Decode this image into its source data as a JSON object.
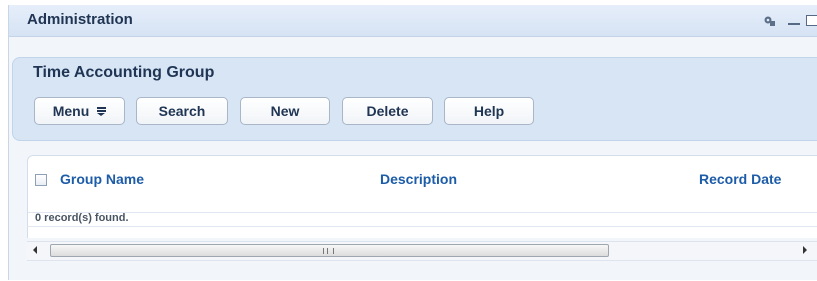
{
  "portlet": {
    "title": "Administration",
    "icons": [
      "refresh-icon",
      "minimize-icon",
      "maximize-icon"
    ]
  },
  "toolbar": {
    "title": "Time Accounting Group",
    "buttons": {
      "menu": "Menu",
      "search": "Search",
      "new": "New",
      "delete": "Delete",
      "help": "Help"
    }
  },
  "grid": {
    "columns": [
      "Group Name",
      "Description",
      "Record Date"
    ],
    "status": "0 record(s) found.",
    "rows": []
  },
  "scrollbar": {
    "grip": "III"
  },
  "colors": {
    "header_bg": "#d6e3f4",
    "panel_bg": "#d7e5f5",
    "column_header": "#1d5ca8",
    "title_text": "#1f3553"
  }
}
